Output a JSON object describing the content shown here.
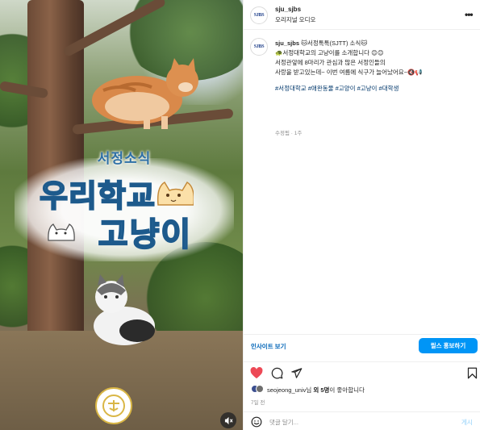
{
  "header": {
    "username": "sju_sjbs",
    "audio": "오리지널 오디오",
    "avatar_text": "SJBS"
  },
  "caption": {
    "username": "sju_sjbs",
    "line1": "🐱서정톡톡(SJTT) 소식🐱",
    "line2": "🐢서정대학교의 고냥이를 소개합니다 😊😊",
    "line3": "서정관앞에 8마리가 관심과 많은 서정인들의",
    "line4": "사랑을 받고있는데~ 이번 여름에 식구가 늘어났어요~🔇📢",
    "hashtags": "#서정대학교 #애완동물 #고양이 #고냥이 #대학생",
    "meta": "수정됨 · 1주"
  },
  "media": {
    "overlay_subtitle": "서정소식",
    "overlay_title_1": "우리학교",
    "overlay_title_2": "고냥이"
  },
  "insights": {
    "link": "인사이트 보기",
    "boost": "릴스 홍보하기"
  },
  "likes": {
    "prefix_user": "seojeong_univ",
    "mid": "님 ",
    "count": "외 5명",
    "suffix": "이 좋아합니다"
  },
  "date": "7일 전",
  "comment": {
    "placeholder": "댓글 달기...",
    "post": "게시"
  },
  "colors": {
    "link": "#0064b7",
    "button": "#0095f6",
    "like": "#ed4956",
    "hashtag": "#00376b"
  }
}
